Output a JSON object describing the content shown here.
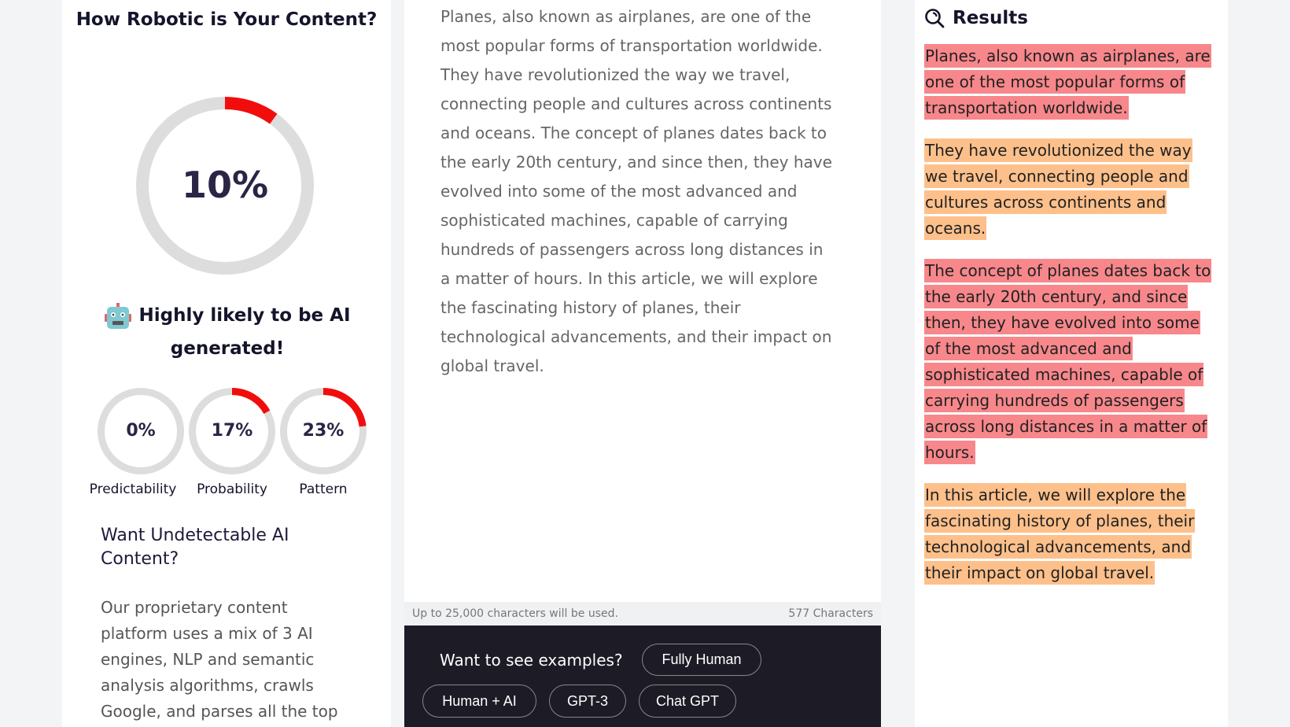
{
  "left": {
    "title": "How Robotic is Your Content?",
    "main_score": {
      "value": 10,
      "label": "10%"
    },
    "verdict": "Highly likely to be AI generated!",
    "verdict_icon": "robot-icon",
    "metrics": [
      {
        "label": "Predictability",
        "value": 0,
        "display": "0%"
      },
      {
        "label": "Probability",
        "value": 17,
        "display": "17%"
      },
      {
        "label": "Pattern",
        "value": 23,
        "display": "23%"
      }
    ],
    "promo_title": "Want Undetectable AI Content?",
    "promo_text": "Our proprietary content platform uses a mix of 3 AI engines, NLP and semantic analysis algorithms, crawls Google, and parses all the top"
  },
  "editor": {
    "text": "Planes, also known as airplanes, are one of the most popular forms of transportation worldwide. They have revolutionized the way we travel, connecting people and cultures across continents and oceans. The concept of planes dates back to the early 20th century, and since then, they have evolved into some of the most advanced and sophisticated machines, capable of carrying hundreds of passengers across long distances in a matter of hours. In this article, we will explore the fascinating history of planes, their technological advancements, and their impact on global travel.",
    "limit_note": "Up to 25,000 characters will be used.",
    "char_count": "577 Characters"
  },
  "examples": {
    "label": "Want to see examples?",
    "buttons": [
      "Fully Human",
      "Human + AI",
      "GPT-3",
      "Chat GPT"
    ]
  },
  "results": {
    "title": "Results",
    "icon": "search-icon",
    "sentences": [
      {
        "text": "Planes, also known as airplanes, are one of the most popular forms of transportation worldwide.",
        "level": "high"
      },
      {
        "text": "They have revolutionized the way we travel, connecting people and cultures across continents and oceans.",
        "level": "medium"
      },
      {
        "text": "The concept of planes dates back to the early 20th century, and since then, they have evolved into some of the most advanced and sophisticated machines, capable of carrying hundreds of passengers across long distances in a matter of hours.",
        "level": "high"
      },
      {
        "text": "In this article, we will explore the fascinating history of planes, their technological advancements, and their impact on global travel.",
        "level": "medium"
      }
    ]
  },
  "colors": {
    "ring_fill": "#f20d0d",
    "ring_track": "#dddddd",
    "high": "#f7878b",
    "medium": "#fdc08b",
    "dark_bar": "#1c1b26"
  }
}
